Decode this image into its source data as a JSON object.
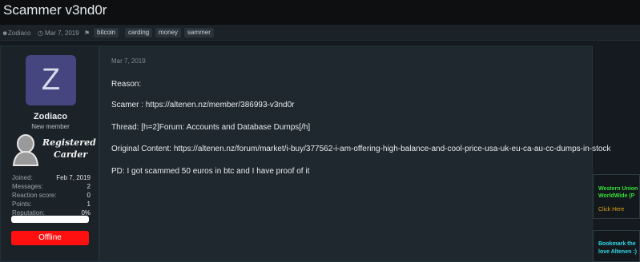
{
  "page_title": "Scammer v3nd0r",
  "meta": {
    "author": "Zodiaco",
    "date": "Mar 7, 2019",
    "tags": [
      "bitcoin",
      "carding",
      "money",
      "sammer"
    ]
  },
  "user": {
    "avatar_letter": "Z",
    "name": "Zodiaco",
    "title": "New member",
    "badge_line1": "Registered",
    "badge_line2": "Carder",
    "stats": [
      {
        "label": "Joined:",
        "value": "Feb 7, 2019"
      },
      {
        "label": "Messages:",
        "value": "2"
      },
      {
        "label": "Reaction score:",
        "value": "0"
      },
      {
        "label": "Points:",
        "value": "1"
      },
      {
        "label": "Reputation:",
        "value": "0%"
      }
    ],
    "reputation_fill": 0,
    "status": "Offline"
  },
  "post": {
    "date": "Mar 7, 2019",
    "lines": [
      "Reason:",
      "Scamer : https://altenen.nz/member/386993-v3nd0r",
      "Thread: [h=2]Forum: Accounts and Database Dumps[/h]",
      "Original Content: https://altenen.nz/forum/market/i-buy/377562-i-am-offering-high-balance-and-cool-price-usa-uk-eu-ca-au-cc-dumps-in-stock",
      "PD: I got scammed 50 euros in btc and I have proof of it"
    ]
  },
  "ads": [
    {
      "line1": "Western Union",
      "line2": "WorldWide (P",
      "cta": "Click Here"
    },
    {
      "line1": "Bookmark the",
      "line2": "love Altenen :)"
    }
  ],
  "colors": {
    "offline": "#ff1010",
    "avatar_bg": "#45467f",
    "ad_green": "#38e03a",
    "ad_cyan": "#35d7e6",
    "ad_cta": "#e0a21a"
  }
}
